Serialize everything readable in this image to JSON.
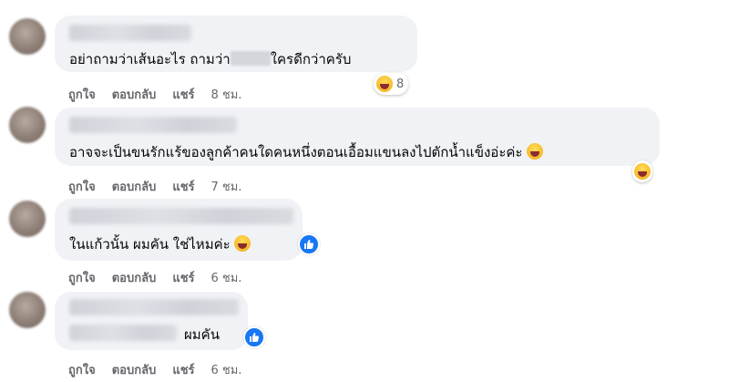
{
  "comments": [
    {
      "text_before": "อย่าถามว่าเส้นอะไร ถามว่า",
      "text_after": "ใครดีกว่าครับ",
      "reaction_count": "8",
      "actions": {
        "like": "ถูกใจ",
        "reply": "ตอบกลับ",
        "share": "แชร์",
        "time": "8 ชม."
      }
    },
    {
      "text": "อาจจะเป็นขนรักแร้ของลูกค้าคนใดคนหนึ่งตอนเอื้อมแขนลงไปตักน้ำแข็งอ่ะค่ะ",
      "actions": {
        "like": "ถูกใจ",
        "reply": "ตอบกลับ",
        "share": "แชร์",
        "time": "7 ชม."
      }
    },
    {
      "text": "ในแก้วนั้น ผมคัน ใช่ไหมค่ะ",
      "actions": {
        "like": "ถูกใจ",
        "reply": "ตอบกลับ",
        "share": "แชร์",
        "time": "6 ชม."
      }
    },
    {
      "text": "ผมคัน",
      "actions": {
        "like": "ถูกใจ",
        "reply": "ตอบกลับ",
        "share": "แชร์",
        "time": "6 ชม."
      }
    }
  ],
  "icons": {
    "laugh": "haha-emoji-icon",
    "like": "like-thumb-icon"
  },
  "colors": {
    "bubble": "#f0f2f5",
    "like_blue": "#1877f2",
    "meta_gray": "#65676b"
  }
}
